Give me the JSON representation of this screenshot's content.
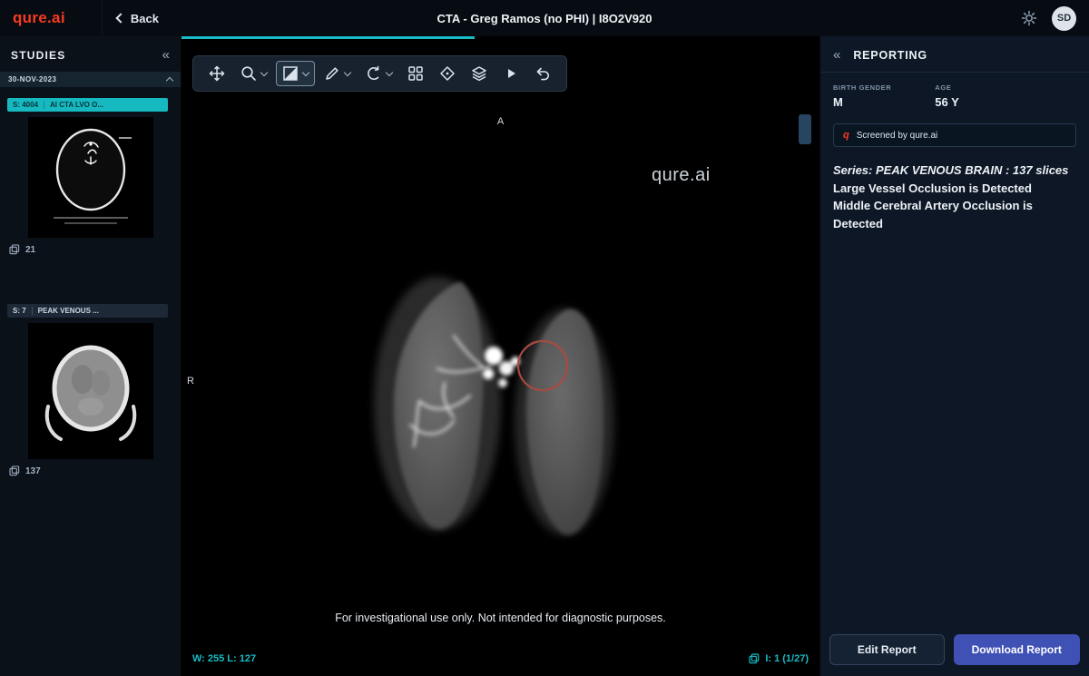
{
  "colors": {
    "accent_teal": "#18bdc6",
    "logo_red": "#f93a22",
    "download_blue": "#3f51b5",
    "annotation_red": "#a84a42"
  },
  "topbar": {
    "logo": "qure.ai",
    "back_label": "Back",
    "title": "CTA - Greg Ramos (no PHI) | I8O2V920",
    "avatar_initials": "SD"
  },
  "sidebar": {
    "title": "STUDIES",
    "collapse_icon": "«",
    "date_group": "30-NOV-2023",
    "series": [
      {
        "id": "S: 4004",
        "name": "AI CTA LVO O...",
        "image_count": "21",
        "selected": true
      },
      {
        "id": "S: 7",
        "name": "PEAK VENOUS ...",
        "image_count": "137",
        "selected": false
      }
    ]
  },
  "viewer": {
    "toolbar_tools": [
      "pan",
      "zoom",
      "window-level",
      "annotate",
      "rotate",
      "layout",
      "probe",
      "stack-scroll",
      "cine-play",
      "undo"
    ],
    "orientation_top": "A",
    "orientation_left": "R",
    "watermark": "qure.ai",
    "annotation": "occlusion-circle",
    "disclaimer": "For investigational use only. Not intended for diagnostic purposes.",
    "window_level": "W: 255 L: 127",
    "slice_indicator": "I: 1 (1/27)"
  },
  "reporting": {
    "title": "REPORTING",
    "expand_icon": "«",
    "demographics": [
      {
        "label": "BIRTH GENDER",
        "value": "M"
      },
      {
        "label": "AGE",
        "value": "56 Y"
      }
    ],
    "screened_logo": "q",
    "screened_by": "Screened by qure.ai",
    "findings": [
      "Series: PEAK VENOUS BRAIN : 137 slices",
      "Large Vessel Occlusion is Detected",
      "Middle Cerebral Artery Occlusion is Detected"
    ],
    "edit_button": "Edit Report",
    "download_button": "Download Report"
  }
}
